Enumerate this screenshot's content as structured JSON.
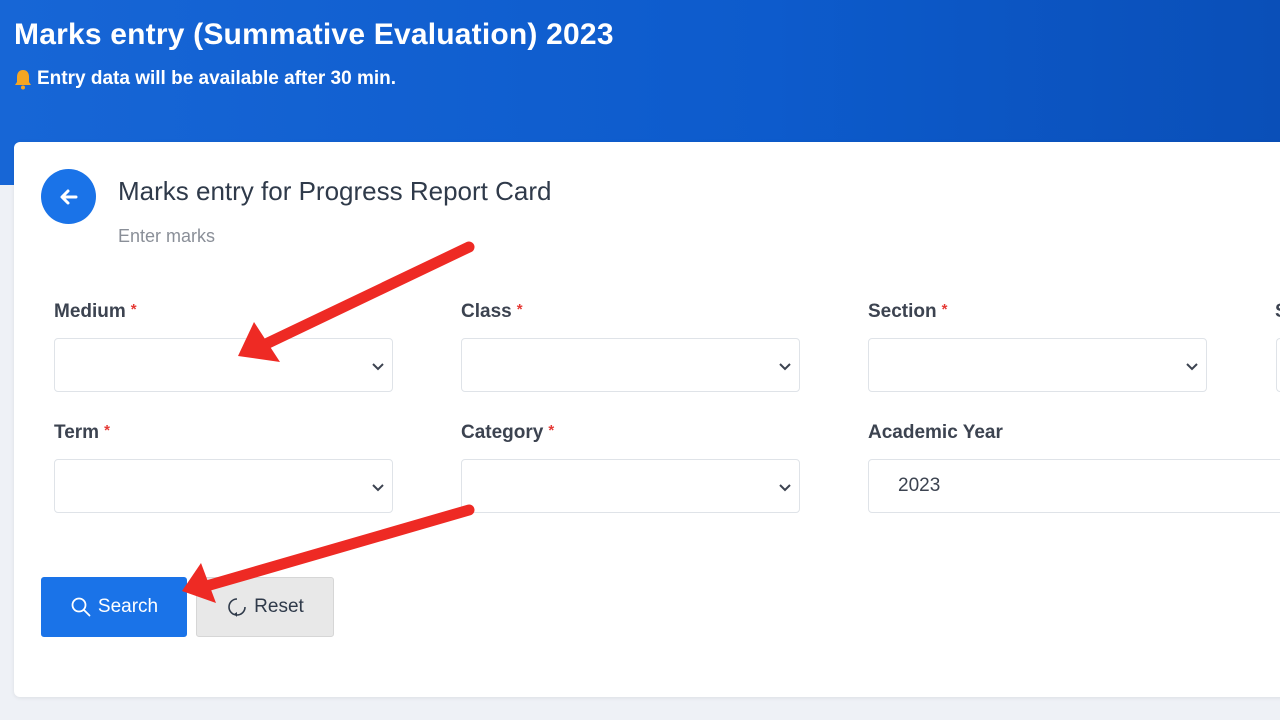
{
  "header": {
    "title": "Marks entry (Summative Evaluation) 2023",
    "note": "Entry data will be available after 30 min."
  },
  "card": {
    "title": "Marks entry for Progress Report Card",
    "subtitle": "Enter marks"
  },
  "form": {
    "required_mark": "*",
    "medium_label": "Medium",
    "class_label": "Class",
    "section_label": "Section",
    "term_label": "Term",
    "category_label": "Category",
    "academic_year_label": "Academic Year",
    "academic_year_value": "2023",
    "partial_label": "S"
  },
  "actions": {
    "search_label": "Search",
    "reset_label": "Reset"
  },
  "colors": {
    "primary": "#1a73e8",
    "banner": "#0d5bcc",
    "required": "#e53935",
    "annotation_arrow": "#ee2a24"
  },
  "icons": {
    "back": "arrow-left-icon",
    "bell": "bell-icon",
    "search": "search-icon",
    "reset": "refresh-icon",
    "dropdown": "chevron-down-icon"
  }
}
